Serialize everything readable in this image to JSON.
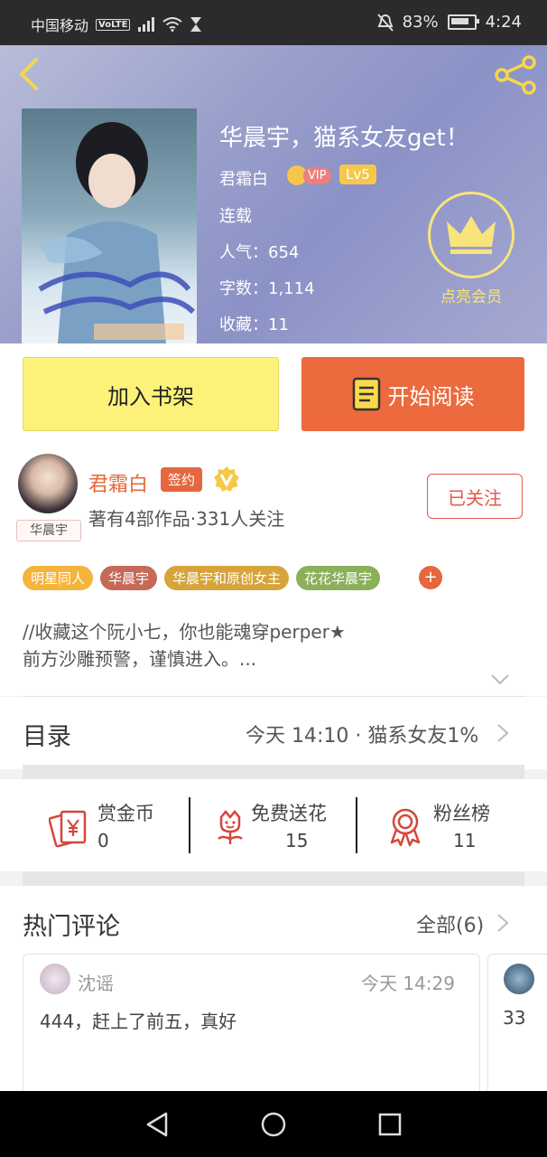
{
  "status_bar": {
    "carrier": "中国移动",
    "volte": "VoLTE",
    "battery_pct": "83%",
    "time": "4:24"
  },
  "book": {
    "title": "华晨宇，猫系女友get！",
    "author": "君霜白",
    "vip_badge": "VIP",
    "level": "Lv5",
    "status": "连载",
    "popularity": "人气：654",
    "word_count": "字数：1,114",
    "favorites": "收藏：11",
    "membership_label": "点亮会员"
  },
  "actions": {
    "add_shelf": "加入书架",
    "start_reading": "开始阅读"
  },
  "author": {
    "name": "君霜白",
    "sign_badge": "签约",
    "avatar_tag": "华晨宇",
    "works": "著有4部作品·331人关注",
    "follow_button": "已关注"
  },
  "tags": [
    {
      "label": "明星同人",
      "color": "#f5b43c"
    },
    {
      "label": "华晨宇",
      "color": "#c46a56"
    },
    {
      "label": "华晨宇和原创女主",
      "color": "#d6a43a"
    },
    {
      "label": "花花华晨宇",
      "color": "#8ab05a"
    }
  ],
  "intro": {
    "line1": "//收藏这个阮小七，你也能魂穿perper★",
    "line2": "前方沙雕预警，谨慎进入。..."
  },
  "catalog": {
    "title": "目录",
    "latest": "今天 14:10 · 猫系女友1%"
  },
  "stats": [
    {
      "label": "赏金币",
      "value": "0",
      "icon": "red-envelope-yen-icon"
    },
    {
      "label": "免费送花",
      "value": "15",
      "icon": "flower-icon"
    },
    {
      "label": "粉丝榜",
      "value": "11",
      "icon": "award-ribbon-icon"
    }
  ],
  "comments": {
    "title": "热门评论",
    "all_label": "全部(6)",
    "items": [
      {
        "user": "沈谣",
        "time": "今天 14:29",
        "text": "444，赶上了前五，真好"
      },
      {
        "text": "33"
      }
    ]
  },
  "colors": {
    "accent": "#ec6a3d",
    "shelf_button": "#fcf27a",
    "author_name": "#e6683a",
    "membership_gold": "#f8e47a"
  }
}
